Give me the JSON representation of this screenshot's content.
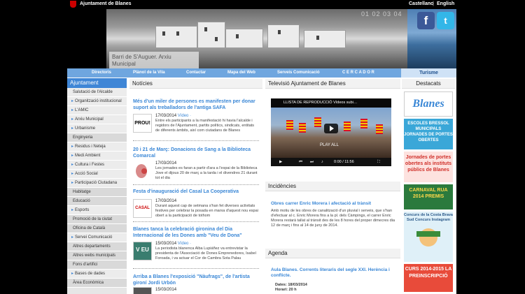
{
  "topbar": {
    "site_name": "Ajuntament de Blanes",
    "lang_es": "Castellano",
    "lang_en": "English"
  },
  "banner": {
    "caption": "Barri de S'Auguer. Arxiu Municipal",
    "counter": "01 02 03 04",
    "facebook": "f",
    "twitter": "t"
  },
  "nav": [
    "Directoris",
    "Plànol de la Vila",
    "Contactar",
    "Mapa del Web",
    "Serveis Comunicació",
    "C E R C A D O R"
  ],
  "nav_turisme": "Turisme",
  "sidebar": {
    "title": "Ajuntament",
    "items": [
      {
        "label": "Salutació de l'Alcalde",
        "type": "dot"
      },
      {
        "label": "Organització institucional",
        "type": "arr"
      },
      {
        "label": "L'AMIC",
        "type": "arr"
      },
      {
        "label": "Arxiu Municipal",
        "type": "arr"
      },
      {
        "label": "Urbanisme",
        "type": "arr"
      },
      {
        "label": "Enginyeria",
        "type": "sub"
      },
      {
        "label": "Residus i Neteja",
        "type": "arr"
      },
      {
        "label": "Medi Ambient",
        "type": "arr"
      },
      {
        "label": "Cultura i Festes",
        "type": "arr"
      },
      {
        "label": "Acció Social",
        "type": "arr"
      },
      {
        "label": "Participació Ciutadana",
        "type": "arr"
      },
      {
        "label": "Habitatge",
        "type": "sub"
      },
      {
        "label": "Educació",
        "type": "sub"
      },
      {
        "label": "Esports",
        "type": "arr"
      },
      {
        "label": "Promoció de la ciutat",
        "type": "sub"
      },
      {
        "label": "Oficina de Català",
        "type": "sub"
      },
      {
        "label": "Servei Comunicació",
        "type": "arr"
      },
      {
        "label": "Altres departaments",
        "type": "sub"
      },
      {
        "label": "Altres webs municipals",
        "type": "sub"
      },
      {
        "label": "Fons d'artifici",
        "type": "sub"
      },
      {
        "label": "Bases de dades",
        "type": "arr"
      },
      {
        "label": "Àrea Econòmica",
        "type": "sub"
      }
    ]
  },
  "noticies": {
    "title": "Notícies",
    "items": [
      {
        "title": "Més d'un miler de persones es manifesten per donar suport als treballadors de l'antiga SAFA",
        "date": "17/03/2014",
        "video": "Vídeo ·",
        "body": "Entre els participants a la manifestació hi havia l'alcalde i regidors de l'Ajuntament, partits polítics, sindicats, entitats de diferents àmbits, així com ciutadans de Blanes"
      },
      {
        "title": "20 i 21 de Març: Donacions de Sang a la Biblioteca Comarcal",
        "date": "17/03/2014",
        "video": "",
        "body": "Les jornades es faran a partir d'ara a l'espai de la Biblioteca Jove el dijous 20 de març a la tarda i el divendres 21 durant tot el dia"
      },
      {
        "title": "Festa d'inauguració del Casal La Cooperativa",
        "date": "17/03/2014",
        "video": "",
        "body": "Durant aquest cap de setmana s'han fet diverses activitats festives per celebrar la posada en marxa d'aquest nou espai obert a la participació de tothom"
      },
      {
        "title": "Blanes tanca la celebració gironina del Dia Internacional de les Dones amb \"Veu de Dona\"",
        "date": "15/03/2014",
        "video": "Vídeo ·",
        "body": "La periodista blanenca Alba Lupiáñez va entrevistar la presidenta de l'Associació de Dones Emprenedores, Isabel Foroada, i va actuar el Cor de Cambra Sota Palau"
      },
      {
        "title": "Arriba a Blanes l'exposició \"Nàufrags\", de l'artista gironí Jordi Urbón",
        "date": "15/03/2014",
        "video": "",
        "body": ""
      }
    ]
  },
  "thumbs": {
    "safa": "PROU!",
    "casal": "CASAL",
    "dona": "V EU"
  },
  "tv": {
    "title": "Televisió Ajuntament de Blanes",
    "video_bar": "LLISTA DE REPRODUCCIÓ     Vídeos subi…",
    "play_all": "PLAY ALL",
    "time": "0:00 / 11:56"
  },
  "incidencies": {
    "title": "Incidències",
    "item_title": "Obres carrer Enric Morera i afectació al trànsit",
    "item_body": "Amb motiu de les obres de canalització d'un pluvial i serveis, que s'han d'efectuar al c. Enric Morera fins a la pl. dels Càmpings, el carrer Enric Morera restarà tallat al trànsit des de les 8 hores del proper dimecres dia 12 de març i fins al 14 de juny de 2014."
  },
  "agenda": {
    "title": "Agenda",
    "item_title": "Aula Blanes. Corrents literaris del segle XXI. Herència i conflicte.",
    "dates": "Dates: 18/03/2014",
    "horari": "Horari: 20 h"
  },
  "destacats": {
    "title": "Destacats",
    "blanes": "Blanes",
    "escoles": "ESCOLES BRESSOL MUNICIPALS JORNADES DE PORTES OBERTES",
    "instituts": "Jornades de portes obertes als instituts públics de Blanes",
    "carnaval": "CARNAVAL RUA 2014 PREMIS",
    "concurs": "Concurs de la Costa Brava Sud Concurs Instagram",
    "curs": "CURS 2014-2015 LA PREINSCRIPCIÓ"
  },
  "colors": {
    "nav": "#6fa6df",
    "link": "#3a87d6",
    "sidebar_head": "#3f86d6"
  }
}
